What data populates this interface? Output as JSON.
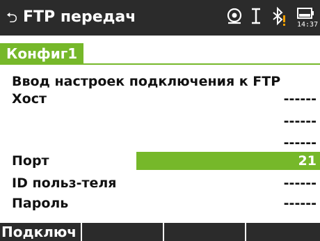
{
  "header": {
    "back_glyph": "⮌",
    "title": "FTP передач",
    "status_icons": [
      "gnss-target-icon",
      "cursor-i-icon",
      "bluetooth-warning-icon",
      "battery-icon"
    ],
    "time": "14:37"
  },
  "tab": {
    "label": "Конфиг1"
  },
  "form": {
    "heading": "Ввод настроек подключения к FTP",
    "host_label": "Хост",
    "host_values": [
      "------",
      "------",
      "------"
    ],
    "port_label": "Порт",
    "port_value": "21",
    "user_label": "ID польз-теля",
    "user_value": "------",
    "password_label": "Пароль",
    "password_value": "------"
  },
  "softkeys": [
    "Подключ",
    "",
    "",
    ""
  ],
  "colors": {
    "accent": "#76b82a",
    "bar": "#2b2b2b",
    "warning": "#f5a000"
  }
}
